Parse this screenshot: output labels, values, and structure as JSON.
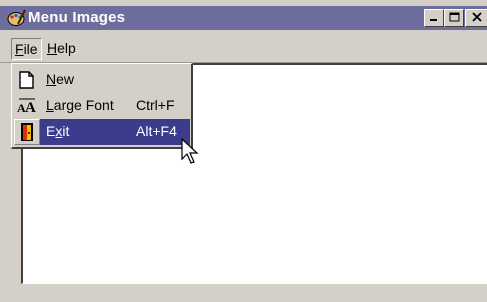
{
  "window": {
    "title": "Menu Images",
    "title_icon": "paint-palette-icon",
    "caption_buttons": {
      "minimize": "minimize-icon",
      "maximize": "maximize-icon",
      "close": "close-icon"
    }
  },
  "menubar": {
    "file": {
      "accel_letter": "F",
      "rest": "ile"
    },
    "help": {
      "accel_letter": "H",
      "rest": "elp"
    }
  },
  "file_menu": {
    "items": [
      {
        "pre": "",
        "accel_letter": "N",
        "post": "ew",
        "shortcut": "",
        "icon": "new-document-icon",
        "selected": false
      },
      {
        "pre": "",
        "accel_letter": "L",
        "post": "arge Font",
        "shortcut": "Ctrl+F",
        "icon": "large-font-icon",
        "selected": false
      },
      {
        "pre": "E",
        "accel_letter": "x",
        "post": "it",
        "shortcut": "Alt+F4",
        "icon": "exit-door-icon",
        "selected": true
      }
    ]
  },
  "colors": {
    "titlebar": "#6e6e9e",
    "selection": "#3c3c8c",
    "face": "#d4d0c8"
  }
}
